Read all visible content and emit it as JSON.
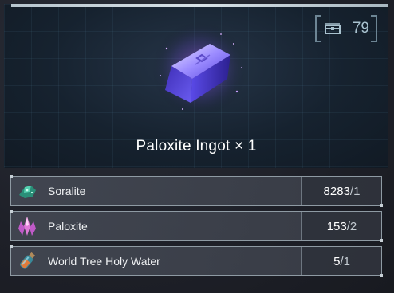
{
  "header": {
    "count_icon": "chest-icon",
    "count_value": "79"
  },
  "item": {
    "name": "Paloxite Ingot",
    "multiplier": "× 1"
  },
  "materials": [
    {
      "icon": "soralite-ore-icon",
      "name": "Soralite",
      "have": "8283",
      "need": "1"
    },
    {
      "icon": "paloxite-crystal-icon",
      "name": "Paloxite",
      "have": "153",
      "need": "2"
    },
    {
      "icon": "holy-water-vial-icon",
      "name": "World Tree Holy Water",
      "have": "5",
      "need": "1"
    }
  ],
  "colors": {
    "ingot_primary": "#6a5cf0",
    "ingot_highlight": "#c7c0ff",
    "ingot_glow": "#c060ff",
    "frame": "#8e9aa3"
  }
}
